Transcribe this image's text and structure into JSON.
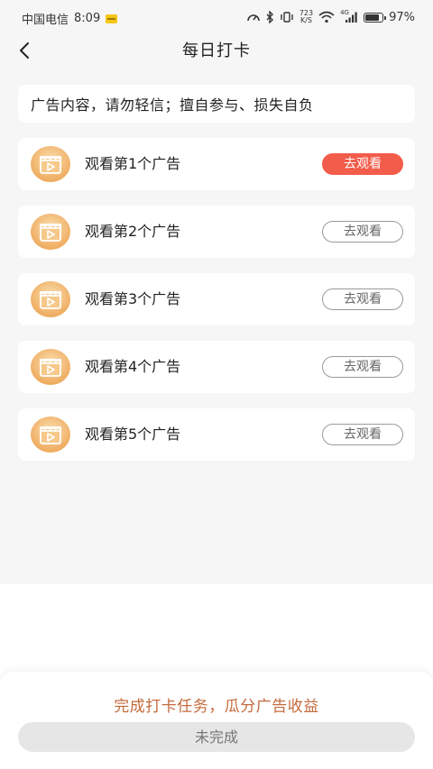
{
  "status_bar": {
    "carrier": "中国电信",
    "time": "8:09",
    "speed_top": "723",
    "speed_bottom": "K/S",
    "network": "4G",
    "battery": "97%"
  },
  "header": {
    "title": "每日打卡",
    "back_icon": "chevron-left-icon"
  },
  "notice": {
    "text": "广告内容，请勿轻信；擅自参与、损失自负"
  },
  "tasks": [
    {
      "label": "观看第1个广告",
      "button": "去观看",
      "active": true
    },
    {
      "label": "观看第2个广告",
      "button": "去观看",
      "active": false
    },
    {
      "label": "观看第3个广告",
      "button": "去观看",
      "active": false
    },
    {
      "label": "观看第4个广告",
      "button": "去观看",
      "active": false
    },
    {
      "label": "观看第5个广告",
      "button": "去观看",
      "active": false
    }
  ],
  "bottom": {
    "text": "完成打卡任务，瓜分广告收益",
    "button": "未完成"
  },
  "colors": {
    "accent": "#f25c4a",
    "bottom_text": "#c46a3c",
    "icon_bg": "#f0b46a",
    "page_bg": "#f6f6f6"
  }
}
